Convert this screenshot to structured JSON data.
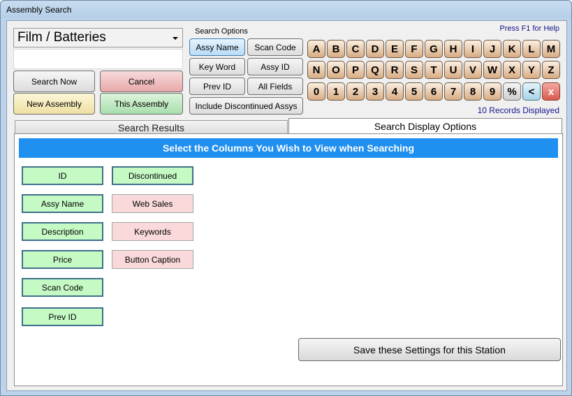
{
  "window": {
    "title": "Assembly Search"
  },
  "category": {
    "value": "Film / Batteries"
  },
  "search": {
    "value": "",
    "placeholder": ""
  },
  "actions": {
    "search_now": "Search Now",
    "cancel": "Cancel",
    "new_assembly": "New Assembly",
    "this_assembly": "This Assembly"
  },
  "search_options": {
    "label": "Search Options",
    "assy_name": "Assy Name",
    "scan_code": "Scan Code",
    "key_word": "Key Word",
    "assy_id": "Assy ID",
    "prev_id": "Prev ID",
    "all_fields": "All Fields",
    "include_discontinued": "Include Discontinued Assys",
    "selected": "Assy Name"
  },
  "keyboard": {
    "help": "Press F1 for Help",
    "row1": [
      "A",
      "B",
      "C",
      "D",
      "E",
      "F",
      "G",
      "H",
      "I",
      "J",
      "K",
      "L",
      "M"
    ],
    "row2": [
      "N",
      "O",
      "P",
      "Q",
      "R",
      "S",
      "T",
      "U",
      "V",
      "W",
      "X",
      "Y",
      "Z"
    ],
    "row3": [
      "0",
      "1",
      "2",
      "3",
      "4",
      "5",
      "6",
      "7",
      "8",
      "9"
    ],
    "percent": "%",
    "backspace": "<",
    "clear": "x",
    "records": "10 Records Displayed"
  },
  "tabs": {
    "results": "Search Results",
    "display_options": "Search Display Options",
    "active": "Search Display Options"
  },
  "display_options": {
    "banner": "Select the Columns You Wish to View when Searching",
    "columns_left": [
      {
        "label": "ID",
        "enabled": true
      },
      {
        "label": "Assy Name",
        "enabled": true
      },
      {
        "label": "Description",
        "enabled": true
      },
      {
        "label": "Price",
        "enabled": true
      },
      {
        "label": "Scan Code",
        "enabled": true
      },
      {
        "label": "Prev ID",
        "enabled": true
      }
    ],
    "columns_right": [
      {
        "label": "Discontinued",
        "enabled": true
      },
      {
        "label": "Web Sales",
        "enabled": false
      },
      {
        "label": "Keywords",
        "enabled": false
      },
      {
        "label": "Button Caption",
        "enabled": false
      }
    ],
    "save": "Save these Settings for this Station"
  },
  "colors": {
    "banner": "#1f8ff0",
    "column_on": "#c5fac5",
    "column_off": "#f9d9d9",
    "key": "#d8ab82",
    "link_text": "#14148c"
  }
}
